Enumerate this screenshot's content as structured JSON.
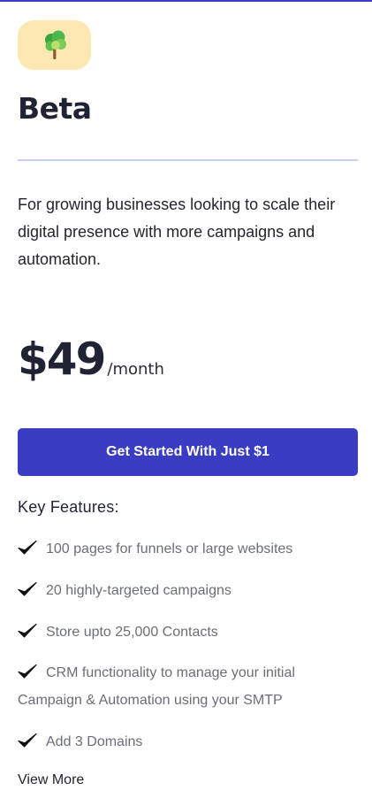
{
  "plan": {
    "icon": "tree-icon",
    "name": "Beta",
    "description": "For growing businesses looking to scale their digital presence with more campaigns and automation.",
    "price": "$49",
    "period": "/month",
    "cta_label": "Get Started With Just $1"
  },
  "features": {
    "heading": "Key Features:",
    "items": [
      "100 pages for funnels or large websites",
      "20 highly-targeted campaigns",
      "Store upto 25,000 Contacts",
      "CRM functionality to manage your initial Campaign & Automation using your SMTP",
      "Add 3 Domains"
    ],
    "check_icon": "checkmark-icon",
    "view_more_label": "View More"
  },
  "colors": {
    "accent": "#3a3dc2",
    "icon_background": "#fde8b4",
    "divider": "#c9cdf0",
    "feature_text": "#6b6e75"
  }
}
